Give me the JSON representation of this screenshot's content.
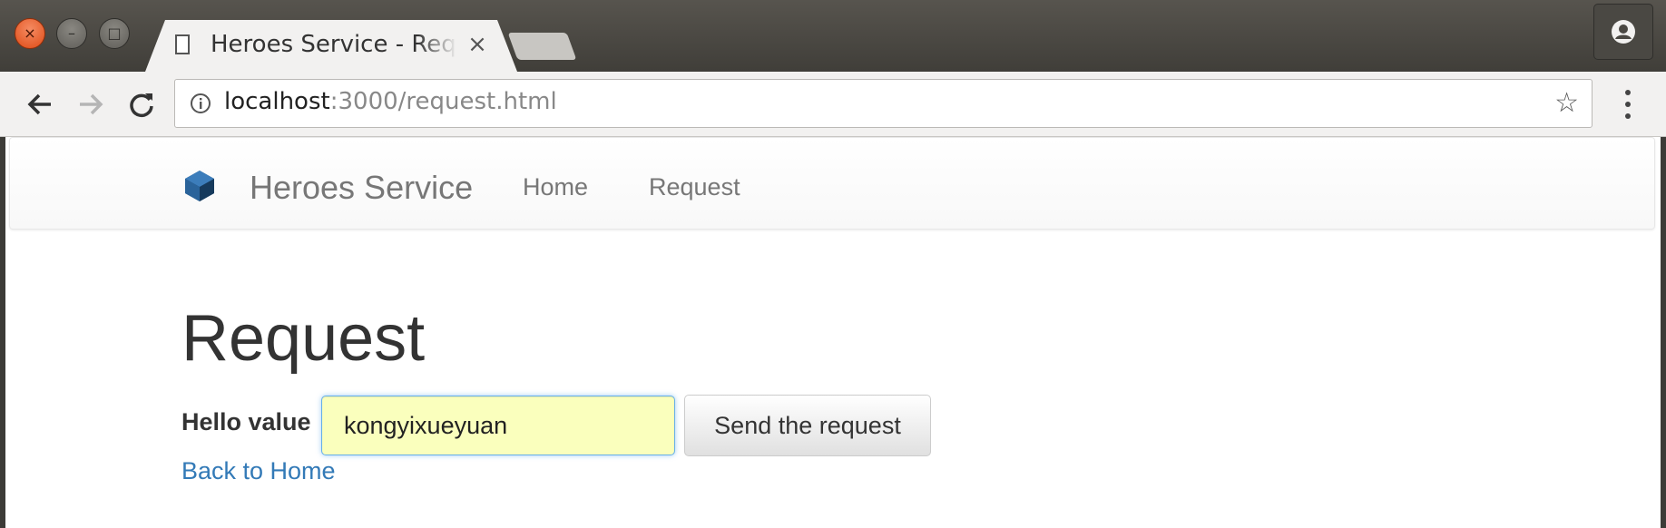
{
  "browser": {
    "tab_title": "Heroes Service - Request",
    "tab_close_glyph": "×",
    "url_host": "localhost",
    "url_rest": ":3000/request.html",
    "star_glyph": "☆",
    "icons": [
      "back-arrow-icon",
      "forward-arrow-icon",
      "reload-icon",
      "info-icon",
      "star-icon",
      "menu-icon",
      "profile-icon",
      "page-icon"
    ]
  },
  "navbar": {
    "brand": "Heroes Service",
    "links": [
      "Home",
      "Request"
    ]
  },
  "main": {
    "title": "Request",
    "field_label": "Hello value",
    "input_value": "kongyixueyuan",
    "button_label": "Send the request",
    "back_link": "Back to Home"
  },
  "colors": {
    "link": "#337ab7",
    "autofill": "#faffbd",
    "focus_border": "#66afe9",
    "title_bar": "#3c3b37",
    "close_button": "#df4b16"
  }
}
